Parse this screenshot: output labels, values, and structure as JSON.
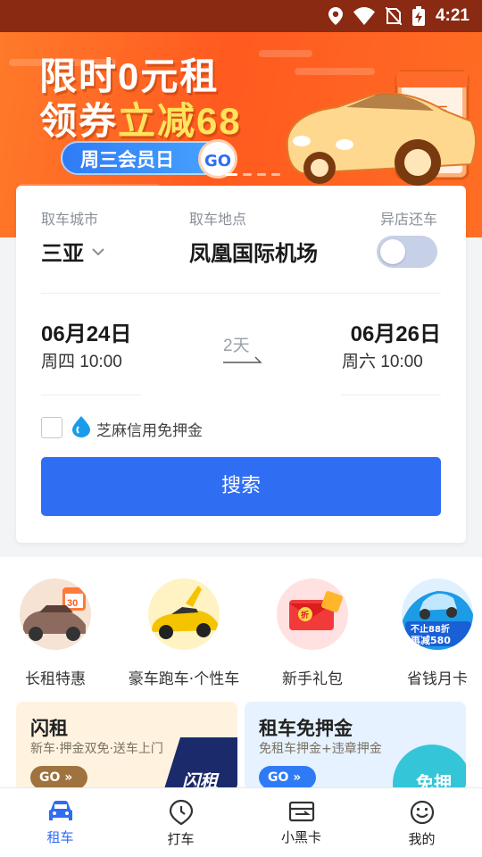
{
  "status_bar": {
    "time": "4:21",
    "icons": [
      "location-icon",
      "wifi-icon",
      "no-sim-icon",
      "battery-charging-icon"
    ]
  },
  "banner": {
    "line1": "限时0元租",
    "line2_prefix": "领券",
    "line2_highlight": "立减68",
    "member_day": "周三会员日",
    "go": "GO",
    "car_plate": "WED周三",
    "carousel_pages": 4,
    "carousel_active": 1,
    "colors": {
      "bg": "#ff5a1f",
      "highlight": "#ffe45c",
      "pill": "#2f7bf6"
    }
  },
  "booking": {
    "city_label": "取车城市",
    "city_value": "三亚",
    "location_label": "取车地点",
    "location_value": "凤凰国际机场",
    "return_diff_label": "异店还车",
    "return_diff_on": false,
    "pickup_date": "06月24日",
    "pickup_time": "周四 10:00",
    "duration": "2天",
    "return_date": "06月26日",
    "return_time": "周六 10:00",
    "sesame_label": "芝麻信用免押金",
    "sesame_checked": false,
    "search_label": "搜索",
    "accent": "#2f6df3"
  },
  "categories": [
    {
      "label": "长租特惠",
      "icon": "suv-calendar-icon",
      "badge": "30"
    },
    {
      "label": "豪车跑车·个性车",
      "icon": "sports-car-icon"
    },
    {
      "label": "新手礼包",
      "icon": "red-envelope-icon",
      "badge": "折"
    },
    {
      "label": "省钱月卡",
      "icon": "monthly-card-icon",
      "badge_line1": "不止88折",
      "badge_line2": "再减580"
    }
  ],
  "promos": [
    {
      "title": "闪租",
      "subtitle": "新车·押金双免·送车上门",
      "go": "GO",
      "tag": "闪租",
      "bg": "#fff3e0",
      "go_color": "#a0733e"
    },
    {
      "title": "租车免押金",
      "subtitle": "免租车押金+违章押金",
      "go": "GO",
      "tag": "免押",
      "bg": "#e6f2ff",
      "go_color": "#2f7bf6"
    }
  ],
  "nav": [
    {
      "label": "租车",
      "icon": "car-icon",
      "active": true
    },
    {
      "label": "打车",
      "icon": "location-pin-icon",
      "active": false
    },
    {
      "label": "小黑卡",
      "icon": "card-icon",
      "active": false
    },
    {
      "label": "我的",
      "icon": "smile-icon",
      "active": false
    }
  ]
}
